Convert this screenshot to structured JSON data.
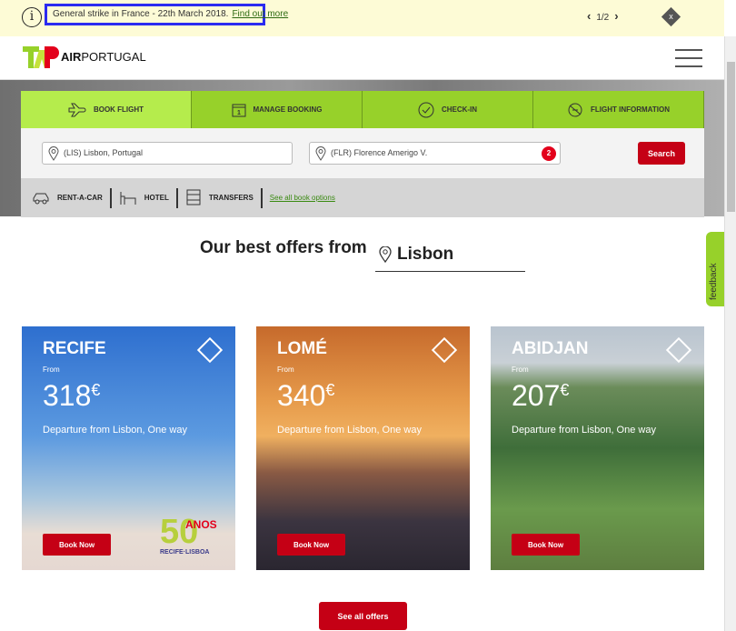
{
  "banner": {
    "notice": "General strike in France - 22th March 2018.",
    "link": "Find out more",
    "pager": "1/2",
    "close": "x",
    "icon": "info-icon"
  },
  "header": {
    "logo_text": "TAP",
    "brand_bold": "AIR",
    "brand_rest": "PORTUGAL"
  },
  "tabs": [
    {
      "label": "BOOK FLIGHT",
      "icon": "plane-icon"
    },
    {
      "label": "MANAGE BOOKING",
      "icon": "calendar-icon"
    },
    {
      "label": "CHECK-IN",
      "icon": "check-icon"
    },
    {
      "label": "FLIGHT INFORMATION",
      "icon": "flight-info-icon"
    }
  ],
  "form": {
    "origin": "(LIS) Lisbon, Portugal",
    "destination": "(FLR) Florence Amerigo V.",
    "destination_badge": "2",
    "search": "Search"
  },
  "extras": [
    {
      "label": "RENT-A-CAR"
    },
    {
      "label": "HOTEL"
    },
    {
      "label": "TRANSFERS"
    }
  ],
  "extras_link": "See all book options",
  "offers": {
    "title": "Our best offers from",
    "city": "Lisbon",
    "see_all": "See all offers",
    "cards": [
      {
        "city": "RECIFE",
        "from": "From",
        "price": "318",
        "currency": "€",
        "departure": "Departure from Lisbon, One way",
        "cta": "Book Now",
        "logo_text": "50 ANOS RECIFE·LISBOA"
      },
      {
        "city": "LOMÉ",
        "from": "From",
        "price": "340",
        "currency": "€",
        "departure": "Departure from Lisbon, One way",
        "cta": "Book Now"
      },
      {
        "city": "ABIDJAN",
        "from": "From",
        "price": "207",
        "currency": "€",
        "departure": "Departure from Lisbon, One way",
        "cta": "Book Now"
      }
    ]
  },
  "feedback": "feedback",
  "colors": {
    "accent_green": "#97d12a",
    "active_tab": "#b5ec4c",
    "cta_red": "#c50015",
    "banner_bg": "#fdfbd6"
  }
}
